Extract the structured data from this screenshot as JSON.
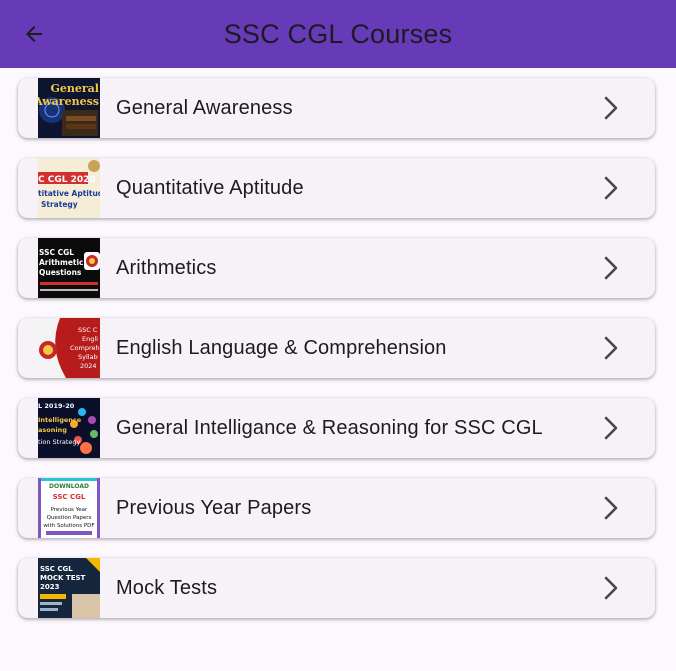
{
  "appbar": {
    "title": "SSC CGL Courses",
    "back_icon": "arrow-left-icon",
    "color": "#673ab7"
  },
  "courses": [
    {
      "label": "General Awareness",
      "thumb": {
        "line1": "General",
        "line2": "Awareness"
      }
    },
    {
      "label": "Quantitative Aptitude",
      "thumb": {
        "line1": "C CGL 2020",
        "line2": "titative Aptitude",
        "line3": "Strategy"
      }
    },
    {
      "label": "Arithmetics",
      "thumb": {
        "line1": "SSC CGL",
        "line2": "Arithmetic",
        "line3": "Questions"
      }
    },
    {
      "label": "English Language & Comprehension",
      "thumb": {
        "line1": "SSC C",
        "line2": "Engli",
        "line3": "Compreher",
        "line4": "Syllab",
        "line5": "2024"
      }
    },
    {
      "label": "General Intelligance & Reasoning for SSC CGL",
      "thumb": {
        "line1": "L 2019-20",
        "line2": "Intelligence",
        "line3": "asoning",
        "line4": "tion Strategy"
      }
    },
    {
      "label": "Previous Year Papers",
      "thumb": {
        "line1": "DOWNLOAD",
        "line2": "SSC CGL",
        "line3": "Previous Year",
        "line4": "Question Papers",
        "line5": "with Solutions PDF"
      }
    },
    {
      "label": "Mock Tests",
      "thumb": {
        "line1": "SSC CGL",
        "line2": "MOCK TEST",
        "line3": "2023"
      }
    }
  ],
  "icons": {
    "chevron": "chevron-right-icon"
  }
}
